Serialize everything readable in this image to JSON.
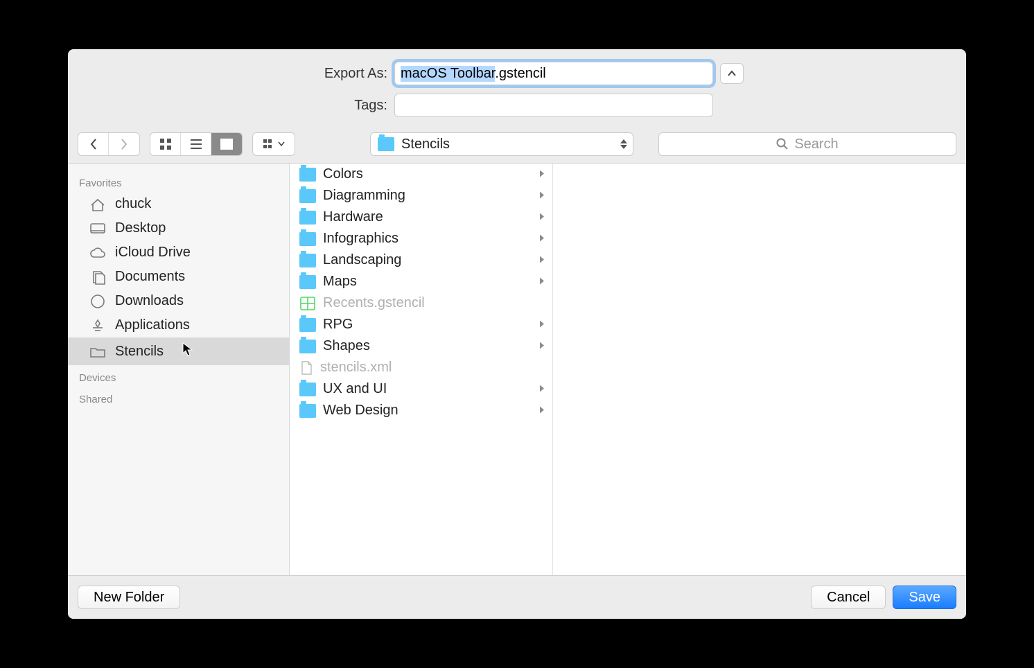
{
  "form": {
    "export_as_label": "Export As:",
    "filename": "macOS Toolbar.gstencil",
    "tags_label": "Tags:",
    "tags_value": ""
  },
  "toolbar": {
    "path_folder": "Stencils",
    "search_placeholder": "Search"
  },
  "sidebar": {
    "sections": [
      {
        "title": "Favorites",
        "items": [
          {
            "label": "chuck",
            "icon": "home"
          },
          {
            "label": "Desktop",
            "icon": "desktop"
          },
          {
            "label": "iCloud Drive",
            "icon": "cloud"
          },
          {
            "label": "Documents",
            "icon": "documents"
          },
          {
            "label": "Downloads",
            "icon": "downloads"
          },
          {
            "label": "Applications",
            "icon": "apps"
          },
          {
            "label": "Stencils",
            "icon": "folder",
            "selected": true
          }
        ]
      },
      {
        "title": "Devices",
        "items": []
      },
      {
        "title": "Shared",
        "items": []
      }
    ]
  },
  "column": {
    "items": [
      {
        "label": "Colors",
        "type": "folder"
      },
      {
        "label": "Diagramming",
        "type": "folder"
      },
      {
        "label": "Hardware",
        "type": "folder"
      },
      {
        "label": "Infographics",
        "type": "folder"
      },
      {
        "label": "Landscaping",
        "type": "folder"
      },
      {
        "label": "Maps",
        "type": "folder"
      },
      {
        "label": "Recents.gstencil",
        "type": "stencil",
        "dimmed": true
      },
      {
        "label": "RPG",
        "type": "folder"
      },
      {
        "label": "Shapes",
        "type": "folder"
      },
      {
        "label": "stencils.xml",
        "type": "file",
        "dimmed": true
      },
      {
        "label": "UX and UI",
        "type": "folder"
      },
      {
        "label": "Web Design",
        "type": "folder"
      }
    ]
  },
  "footer": {
    "new_folder": "New Folder",
    "cancel": "Cancel",
    "save": "Save"
  }
}
